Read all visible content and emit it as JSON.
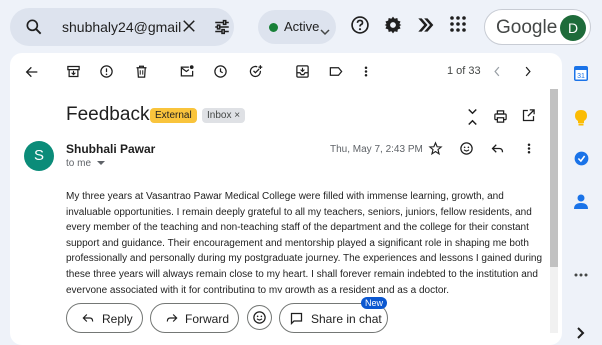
{
  "search": {
    "value": "shubhaly24@gmail"
  },
  "status": {
    "label": "Active",
    "color": "#188038"
  },
  "account": {
    "brand": "Google",
    "avatar_letter": "D"
  },
  "toolbar": {
    "pager": "1 of 33"
  },
  "email": {
    "subject": "Feedback",
    "labels": {
      "external": "External",
      "inbox": "Inbox ×"
    },
    "sender_initial": "S",
    "sender_name": "Shubhali Pawar",
    "to": "to me",
    "date": "Thu, May 7, 2:43 PM",
    "body": "My three years at Vasantrao Pawar Medical College were filled with immense learning, growth, and invaluable opportunities. I remain deeply grateful to all my teachers, seniors, juniors, fellow residents, and every member of the teaching and non-teaching staff of the department and the college for their constant support and guidance. Their encouragement and mentorship played a significant role in shaping me both professionally and personally during my postgraduate journey. The experiences and lessons I gained during these three years will always remain close to my heart. I shall forever remain indebted to the institution and everyone associated with it for contributing to my growth as a resident and as a doctor."
  },
  "actions": {
    "reply": "Reply",
    "forward": "Forward",
    "share": "Share in chat",
    "new_badge": "New"
  },
  "rail": {
    "calendar_day": "31"
  }
}
